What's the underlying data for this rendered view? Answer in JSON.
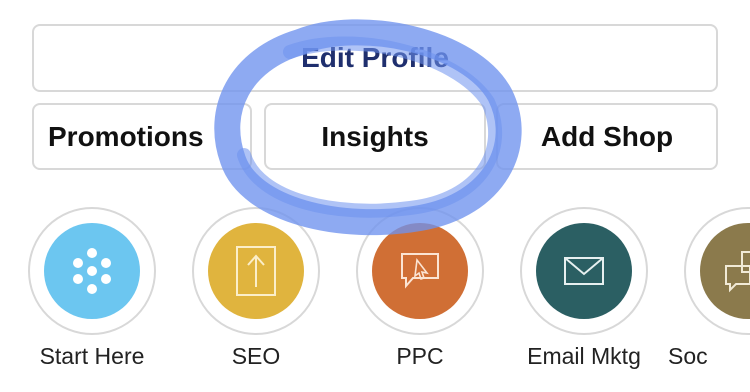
{
  "buttons": {
    "edit_profile": "Edit Profile",
    "promotions": "Promotions",
    "insights": "Insights",
    "add_shop": "Add Shop"
  },
  "tools": [
    {
      "label": "Start Here",
      "icon": "dots-icon",
      "color": "#6cc6f0"
    },
    {
      "label": "SEO",
      "icon": "upload-doc-icon",
      "color": "#e0b43e"
    },
    {
      "label": "PPC",
      "icon": "click-chat-icon",
      "color": "#d06f35"
    },
    {
      "label": "Email Mktg",
      "icon": "envelope-icon",
      "color": "#2b5f63"
    },
    {
      "label": "Soc",
      "icon": "chat-bubbles-icon",
      "color": "#8b7a4c"
    }
  ],
  "colors": {
    "highlight": "#6e92ee",
    "button_border": "#d8d8d8",
    "edit_profile_text": "#1f2f6e"
  }
}
